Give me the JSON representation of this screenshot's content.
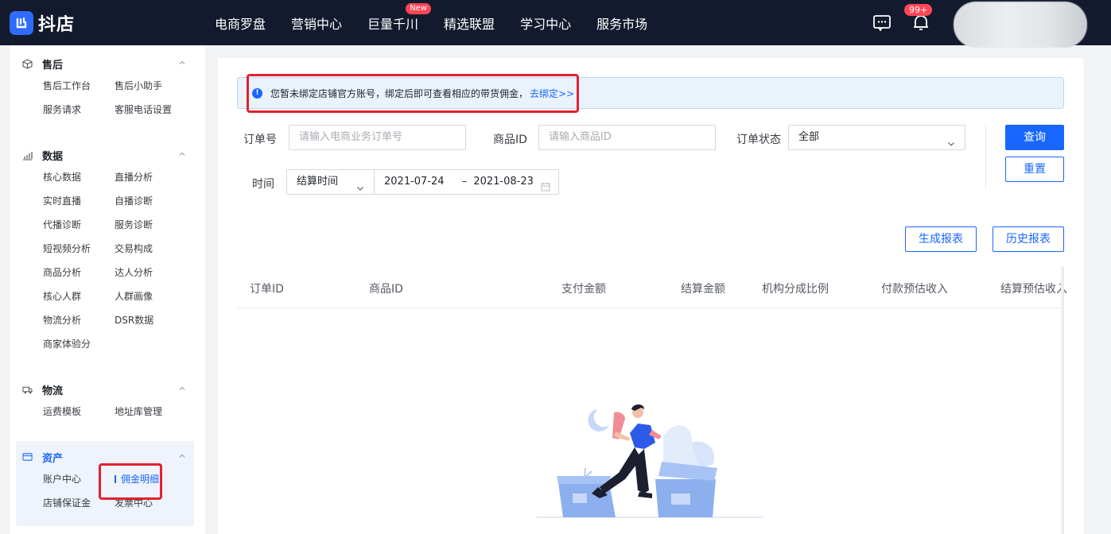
{
  "brand": {
    "name": "抖店",
    "accent": "#1966ff",
    "topbar_bg": "#141a2e"
  },
  "topnav": [
    {
      "label": "电商罗盘"
    },
    {
      "label": "营销中心"
    },
    {
      "label": "巨量千川",
      "badge": "New"
    },
    {
      "label": "精选联盟"
    },
    {
      "label": "学习中心"
    },
    {
      "label": "服务市场"
    }
  ],
  "top_right": {
    "notification_count": "99+",
    "chat_icon": "message-icon",
    "bell_icon": "bell-icon"
  },
  "sidebar": {
    "after_sales": {
      "title": "售后",
      "items": [
        "售后工作台",
        "售后小助手",
        "服务请求",
        "客服电话设置"
      ]
    },
    "data": {
      "title": "数据",
      "items": [
        "核心数据",
        "直播分析",
        "实时直播",
        "自播诊断",
        "代播诊断",
        "服务诊断",
        "短视频分析",
        "交易构成",
        "商品分析",
        "达人分析",
        "核心人群",
        "人群画像",
        "物流分析",
        "DSR数据",
        "商家体验分"
      ]
    },
    "logistics": {
      "title": "物流",
      "items": [
        "运费模板",
        "地址库管理"
      ]
    },
    "assets": {
      "title": "资产",
      "items": [
        "账户中心",
        "佣金明细",
        "店铺保证金",
        "发票中心"
      ],
      "active": "佣金明细"
    }
  },
  "notice": {
    "text": "您暂未绑定店铺官方账号，绑定后即可查看相应的带货佣金，",
    "link": "去绑定>>"
  },
  "filters": {
    "order_no_label": "订单号",
    "order_no_placeholder": "请输入电商业务订单号",
    "product_id_label": "商品ID",
    "product_id_placeholder": "请输入商品ID",
    "status_label": "订单状态",
    "status_value": "全部",
    "time_label": "时间",
    "time_type": "结算时间",
    "date_start": "2021-07-24",
    "date_sep": "–",
    "date_end": "2021-08-23"
  },
  "buttons": {
    "query": "查询",
    "reset": "重置",
    "generate_report": "生成报表",
    "history_report": "历史报表"
  },
  "table": {
    "columns": [
      "订单ID",
      "商品ID",
      "支付金额",
      "结算金额",
      "机构分成比例",
      "付款预估收入",
      "结算预估收入"
    ]
  }
}
